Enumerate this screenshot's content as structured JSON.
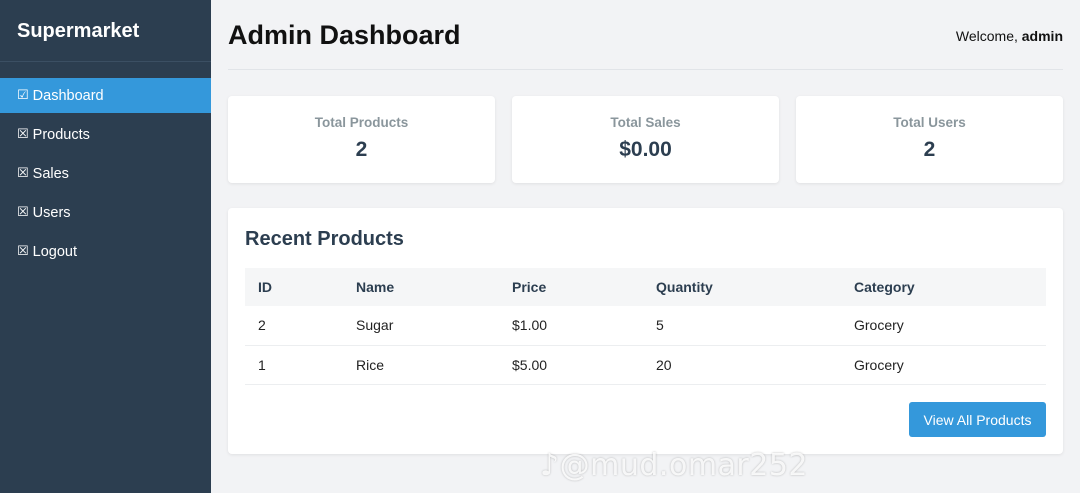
{
  "sidebar": {
    "brand": "Supermarket",
    "items": [
      {
        "icon": "☑",
        "label": "Dashboard",
        "active": true
      },
      {
        "icon": "☒",
        "label": "Products"
      },
      {
        "icon": "☒",
        "label": "Sales"
      },
      {
        "icon": "☒",
        "label": "Users"
      },
      {
        "icon": "☒",
        "label": "Logout"
      }
    ]
  },
  "header": {
    "title": "Admin Dashboard",
    "welcome_prefix": "Welcome, ",
    "username": "admin"
  },
  "stats": [
    {
      "label": "Total Products",
      "value": "2"
    },
    {
      "label": "Total Sales",
      "value": "$0.00"
    },
    {
      "label": "Total Users",
      "value": "2"
    }
  ],
  "recent": {
    "title": "Recent Products",
    "columns": [
      "ID",
      "Name",
      "Price",
      "Quantity",
      "Category"
    ],
    "rows": [
      [
        "2",
        "Sugar",
        "$1.00",
        "5",
        "Grocery"
      ],
      [
        "1",
        "Rice",
        "$5.00",
        "20",
        "Grocery"
      ]
    ],
    "button_label": "View All Products"
  },
  "watermark": "♪@mud.omar252",
  "colors": {
    "sidebar_bg": "#2c3e50",
    "accent": "#3498db",
    "page_bg": "#f2f3f5"
  }
}
